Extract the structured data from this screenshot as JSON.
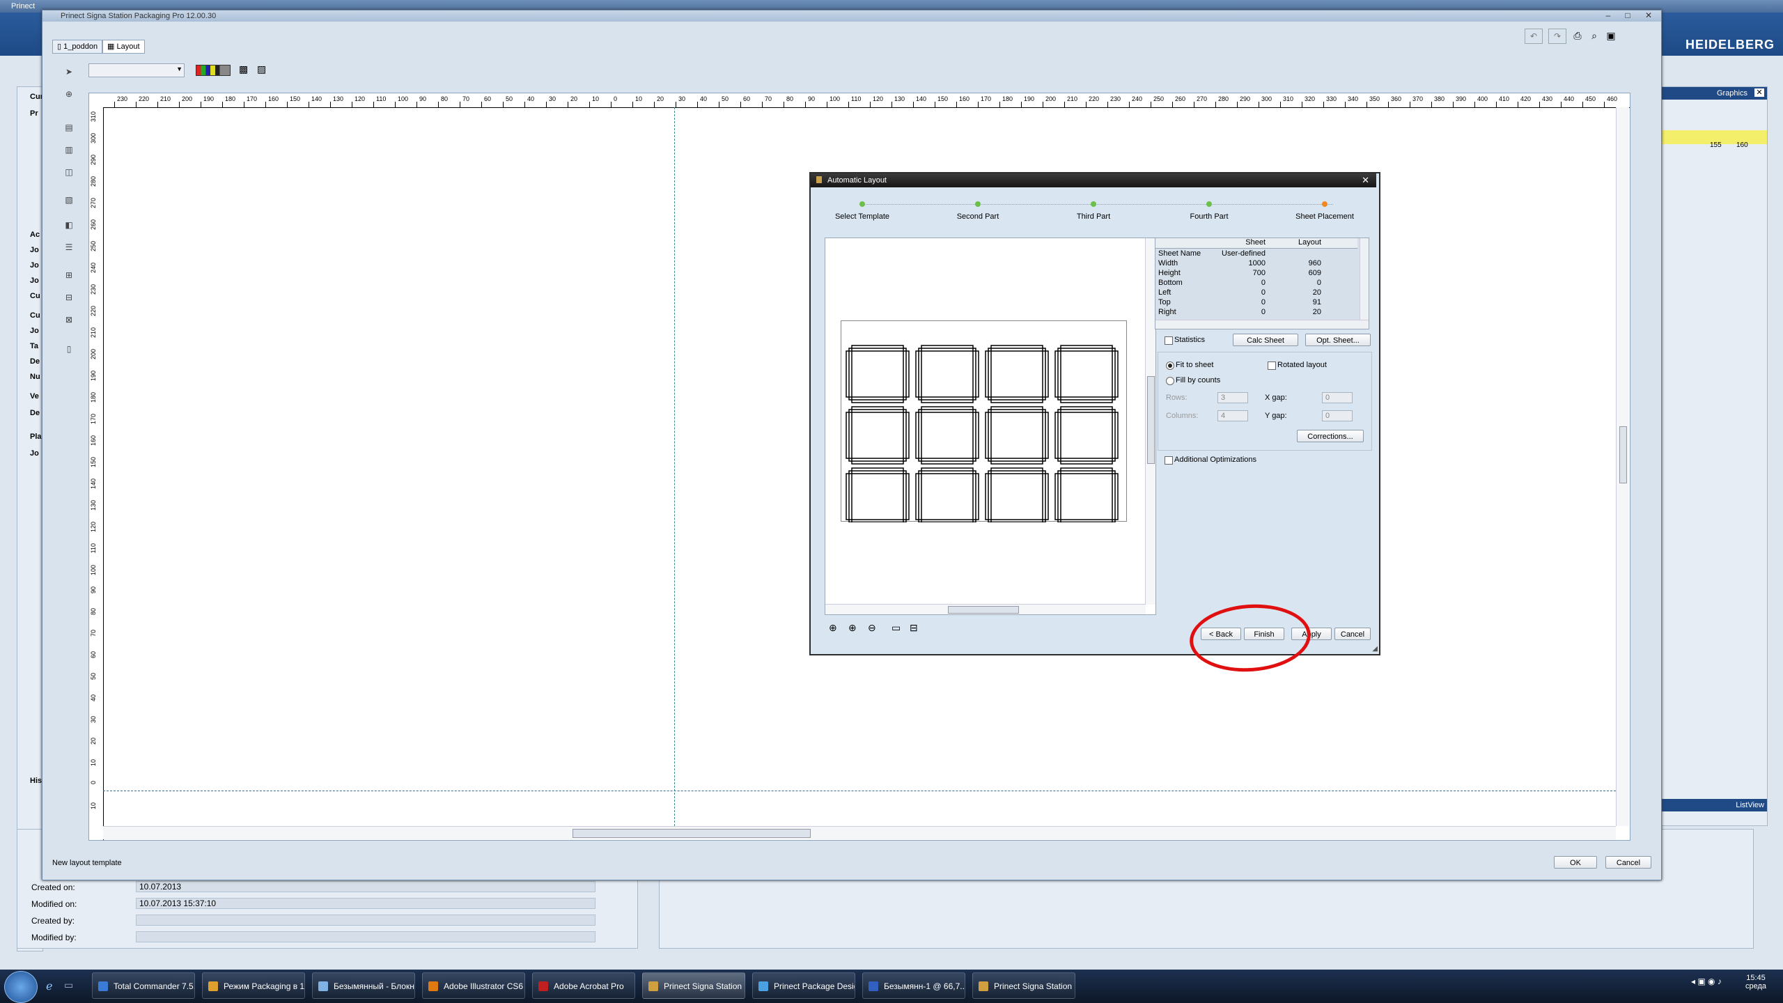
{
  "background_app": {
    "title": "Prinect",
    "logo": "HEIDELBERG",
    "right_panel_title": "Graphics",
    "list_view": "ListView",
    "left_stubs": [
      "Curr",
      "Pr",
      "Ac",
      "Jo",
      "Jo",
      "Jo",
      "Cu",
      "Cu",
      "Jo",
      "Ta",
      "De",
      "Nu",
      "Ve",
      "De",
      "Pla",
      "Jo",
      "His"
    ],
    "ruler_marks": [
      "155",
      "160"
    ],
    "properties": [
      {
        "label": "Created on:",
        "value": "10.07.2013"
      },
      {
        "label": "Modified on:",
        "value": "10.07.2013  15:37:10"
      },
      {
        "label": "Created by:",
        "value": ""
      },
      {
        "label": "Modified by:",
        "value": ""
      }
    ]
  },
  "main_window": {
    "title": "Prinect Signa Station Packaging Pro 12.00.30",
    "tabs": [
      {
        "label": "1_poddon"
      },
      {
        "label": "Layout"
      }
    ],
    "status_text": "New layout template",
    "ok_label": "OK",
    "cancel_label": "Cancel",
    "ruler_h_labels": [
      "230",
      "220",
      "210",
      "200",
      "190",
      "180",
      "170",
      "160",
      "150",
      "140",
      "130",
      "120",
      "110",
      "100",
      "90",
      "80",
      "70",
      "60",
      "50",
      "40",
      "30",
      "20",
      "10",
      "0",
      "10",
      "20",
      "30",
      "40",
      "50",
      "60",
      "70",
      "80",
      "90",
      "100",
      "110",
      "120",
      "130",
      "140",
      "150",
      "160",
      "170",
      "180",
      "190",
      "200",
      "210",
      "220",
      "230",
      "240",
      "250",
      "260",
      "270",
      "280",
      "290",
      "300",
      "310",
      "320",
      "330",
      "340",
      "350",
      "360",
      "370",
      "380",
      "390",
      "400",
      "410",
      "420",
      "430",
      "440",
      "450",
      "460"
    ],
    "ruler_v_labels": [
      "310",
      "300",
      "290",
      "280",
      "270",
      "260",
      "250",
      "240",
      "230",
      "220",
      "210",
      "200",
      "190",
      "180",
      "170",
      "160",
      "150",
      "140",
      "130",
      "120",
      "110",
      "100",
      "90",
      "80",
      "70",
      "60",
      "50",
      "40",
      "30",
      "20",
      "10",
      "0",
      "10"
    ]
  },
  "dialog": {
    "title": "Automatic Layout",
    "steps": [
      {
        "label": "Select Template",
        "state": "done"
      },
      {
        "label": "Second Part",
        "state": "done"
      },
      {
        "label": "Third Part",
        "state": "done"
      },
      {
        "label": "Fourth Part",
        "state": "done"
      },
      {
        "label": "Sheet Placement",
        "state": "current"
      }
    ],
    "table": {
      "headers": [
        "",
        "Sheet",
        "Layout"
      ],
      "rows": [
        {
          "name": "Sheet Name",
          "sheet": "User-defined",
          "layout": ""
        },
        {
          "name": "Width",
          "sheet": "1000",
          "layout": "960"
        },
        {
          "name": "Height",
          "sheet": "700",
          "layout": "609"
        },
        {
          "name": "Bottom",
          "sheet": "0",
          "layout": "0"
        },
        {
          "name": "Left",
          "sheet": "0",
          "layout": "20"
        },
        {
          "name": "Top",
          "sheet": "0",
          "layout": "91"
        },
        {
          "name": "Right",
          "sheet": "0",
          "layout": "20"
        }
      ]
    },
    "statistics_label": "Statistics",
    "calc_sheet_label": "Calc Sheet",
    "opt_sheet_label": "Opt. Sheet...",
    "fit_to_sheet_label": "Fit to sheet",
    "fill_by_counts_label": "Fill by counts",
    "rotated_layout_label": "Rotated layout",
    "rows_label": "Rows:",
    "rows_value": "3",
    "columns_label": "Columns:",
    "columns_value": "4",
    "xgap_label": "X gap:",
    "xgap_value": "0",
    "ygap_label": "Y gap:",
    "ygap_value": "0",
    "corrections_label": "Corrections...",
    "additional_opt_label": "Additional Optimizations",
    "back_label": "< Back",
    "finish_label": "Finish",
    "apply_label": "Apply",
    "cancel_label": "Cancel"
  },
  "taskbar": {
    "items": [
      {
        "label": "Total Commander 7.5...",
        "color": "#3a7bd5"
      },
      {
        "label": "Режим Packaging в 1...",
        "color": "#e0a030"
      },
      {
        "label": "Безымянный - Блокнот",
        "color": "#7fb2e5"
      },
      {
        "label": "Adobe Illustrator CS6",
        "color": "#e07a10"
      },
      {
        "label": "Adobe Acrobat Pro",
        "color": "#c02020"
      },
      {
        "label": "Prinect Signa Station ...",
        "color": "#d0a040"
      },
      {
        "label": "Prinect Package Desig...",
        "color": "#4aa0e0"
      },
      {
        "label": "Безымянн-1 @ 66,7...",
        "color": "#3060c0"
      },
      {
        "label": "Prinect Signa Station ...",
        "color": "#d0a040"
      }
    ],
    "time": "15:45",
    "day": "среда"
  }
}
